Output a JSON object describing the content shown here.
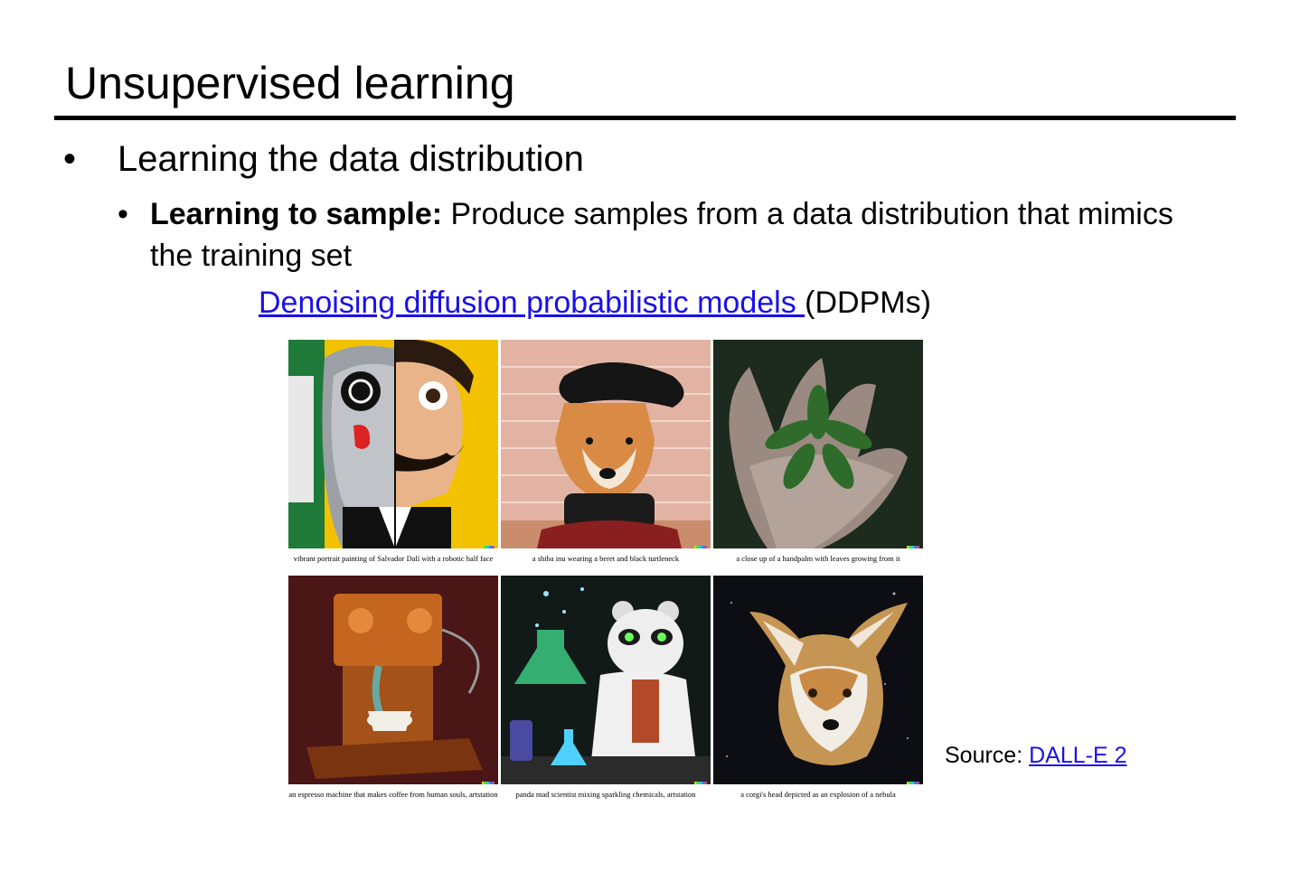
{
  "slide": {
    "title": "Unsupervised learning",
    "bullet1": "Learning the data distribution",
    "bullet2_bold": "Learning to sample:",
    "bullet2_text": " Produce samples from a data distribution that mimics the training set",
    "ddpm_link": "Denoising diffusion probabilistic models ",
    "ddpm_suffix": "(DDPMs)",
    "bullet_glyph": "•"
  },
  "images": [
    {
      "caption": "vibrant portrait painting of Salvador Dalí with a robotic half face",
      "icon": "dali-robot-portrait-image"
    },
    {
      "caption": "a shiba inu wearing a beret and black turtleneck",
      "icon": "shiba-inu-beret-image"
    },
    {
      "caption": "a close up of a handpalm with leaves growing from it",
      "icon": "palm-leaves-image"
    },
    {
      "caption": "an espresso machine that makes coffee from human souls, artstation",
      "icon": "espresso-machine-image"
    },
    {
      "caption": "panda mad scientist mixing sparkling chemicals, artstation",
      "icon": "panda-scientist-image"
    },
    {
      "caption": "a corgi's head depicted as an explosion of a nebula",
      "icon": "corgi-nebula-image"
    }
  ],
  "source": {
    "label": "Source: ",
    "link": "DALL-E 2"
  },
  "colors": {
    "link": "#1a10e8"
  }
}
